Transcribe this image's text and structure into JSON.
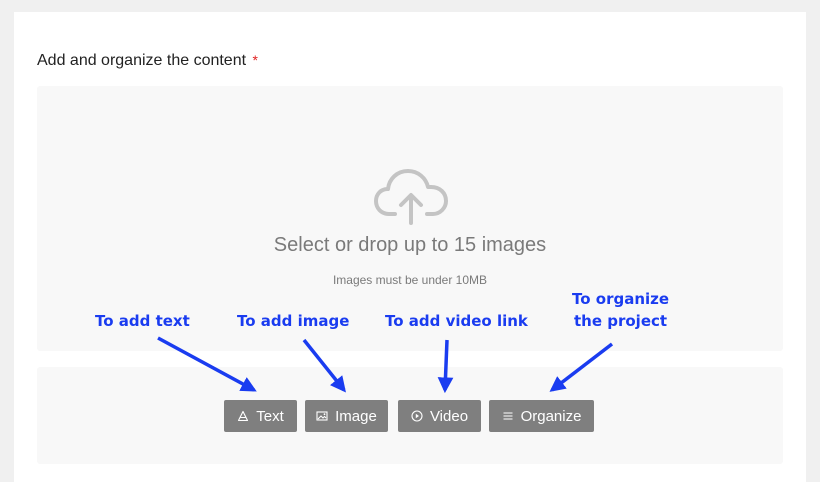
{
  "section": {
    "title": "Add and organize the content",
    "required_marker": "*"
  },
  "dropzone": {
    "icon": "cloud-upload-icon",
    "title": "Select or drop up to 15 images",
    "hint": "Images must be under 10MB"
  },
  "toolbar": {
    "buttons": [
      {
        "label": "Text",
        "icon": "text-icon"
      },
      {
        "label": "Image",
        "icon": "image-icon"
      },
      {
        "label": "Video",
        "icon": "video-icon"
      },
      {
        "label": "Organize",
        "icon": "organize-icon"
      }
    ]
  },
  "annotations": {
    "text": "To add text",
    "image": "To add image",
    "video": "To add video link",
    "organize_line1": "To organize",
    "organize_line2": "the project"
  },
  "colors": {
    "annotation": "#1a3cf0",
    "button_bg": "#7f7f7f",
    "required": "#e02020",
    "muted_text": "#7a7a7a"
  }
}
